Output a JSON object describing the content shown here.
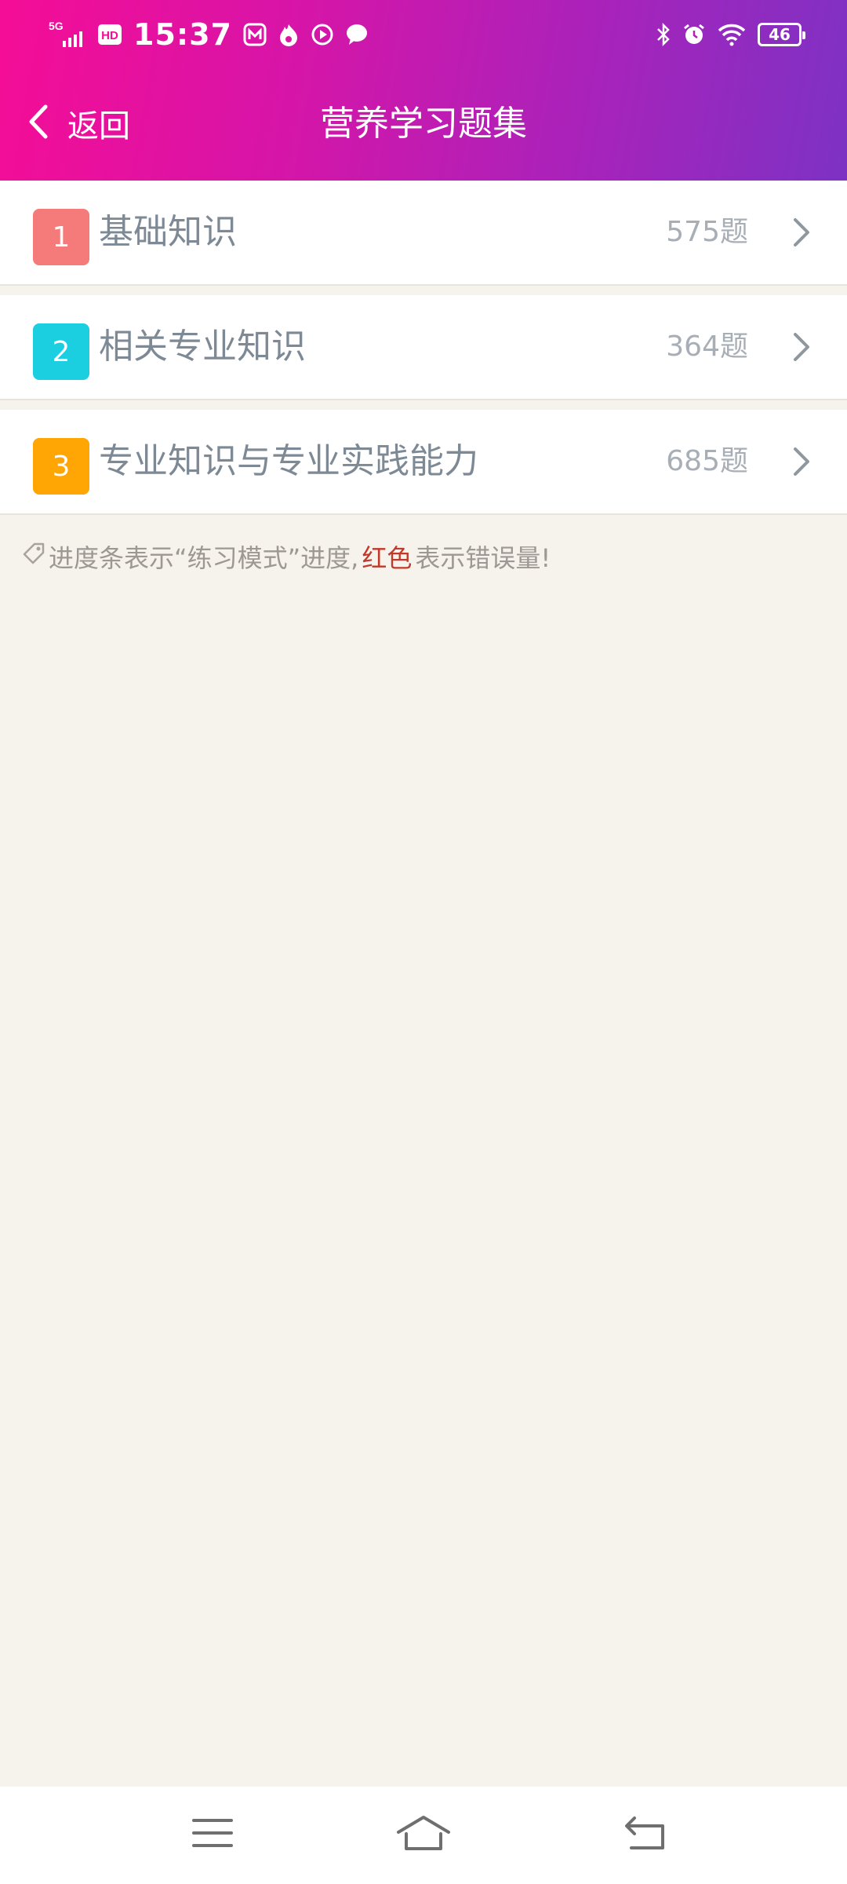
{
  "status_bar": {
    "time": "15:37",
    "network": "5G",
    "hd": "HD",
    "battery": "46",
    "left_icons": [
      "network-signal-icon",
      "hd-icon",
      "app-m-icon",
      "flame-app-icon",
      "play-app-icon",
      "chat-icon"
    ],
    "right_icons": [
      "bluetooth-icon",
      "alarm-icon",
      "wifi-icon",
      "battery-icon"
    ]
  },
  "header": {
    "back_label": "返回",
    "title": "营养学习题集"
  },
  "list": {
    "items": [
      {
        "index": "1",
        "title": "基础知识",
        "count": "575题",
        "color": "#f57b7a"
      },
      {
        "index": "2",
        "title": "相关专业知识",
        "count": "364题",
        "color": "#1ccfe0"
      },
      {
        "index": "3",
        "title": "专业知识与专业实践能力",
        "count": "685题",
        "color": "#ffa604"
      }
    ]
  },
  "hint": {
    "before": "进度条表示“练习模式”进度,",
    "red": "红色",
    "after": "表示错误量!"
  },
  "colors": {
    "header_gradient_start": "#f50d96",
    "header_gradient_end": "#7d32c4",
    "background": "#f6f2ec",
    "error_red": "#c0392b"
  },
  "system_nav": [
    "menu-icon",
    "home-icon",
    "back-icon"
  ]
}
